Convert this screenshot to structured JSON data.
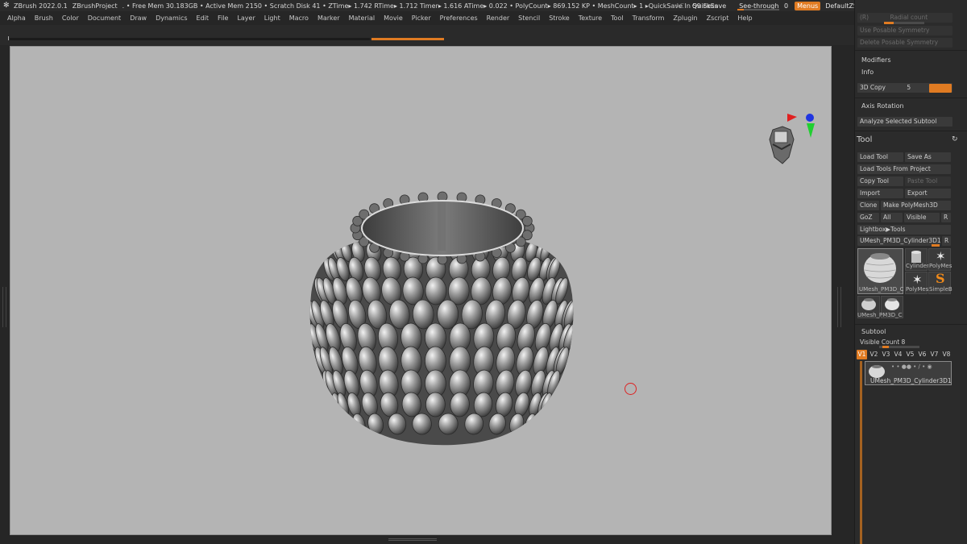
{
  "titlebar": {
    "app": "ZBrush 2022.0.1",
    "project": "ZBrushProject",
    "stats": ". • Free Mem 30.183GB • Active Mem 2150 • Scratch Disk 41 •  ZTime▸ 1.742 RTime▸ 1.712 Timer▸ 1.616 ATime▸ 0.022 • PolyCount▸ 869.152 KP  • MeshCount▸ 1  ▸QuickSave In 59 Secs",
    "ac": "AC",
    "quicksave": "QuickSave",
    "seethrough": "See-through",
    "seethrough_value": "0",
    "seethrough_level": 0.0,
    "menus": "Menus",
    "script": "DefaultZScript"
  },
  "menubar": [
    "Alpha",
    "Brush",
    "Color",
    "Document",
    "Draw",
    "Dynamics",
    "Edit",
    "File",
    "Layer",
    "Light",
    "Macro",
    "Marker",
    "Material",
    "Movie",
    "Picker",
    "Preferences",
    "Render",
    "Stencil",
    "Stroke",
    "Texture",
    "Tool",
    "Transform",
    "Zplugin",
    "Zscript",
    "Help"
  ],
  "tray": {
    "top_items": {
      "radial": "Radial count",
      "radial_prefix": "(R)",
      "use_posable": "Use Posable Symmetry",
      "delete_posable": "Delete Posable Symmetry",
      "modifiers": "Modifiers",
      "info": "Info",
      "copy3d": "3D Copy",
      "copy3d_value": "5",
      "axis_rotation": "Axis Rotation",
      "analyze": "Analyze Selected Subtool"
    },
    "tool": {
      "title": "Tool",
      "load_tool": "Load Tool",
      "save_as": "Save As",
      "load_from_project": "Load Tools From Project",
      "copy_tool": "Copy Tool",
      "paste_tool": "Paste Tool",
      "import": "Import",
      "export": "Export",
      "clone": "Clone",
      "make_polymesh": "Make PolyMesh3D",
      "goz": "GoZ",
      "all": "All",
      "visible": "Visible",
      "r": "R",
      "lightbox": "Lightbox▶Tools",
      "current_tool": "UMesh_PM3D_Cylinder3D1",
      "current_r": "R",
      "thumbs": {
        "main": "UMesh_PM3D_C",
        "cylinder": "Cylinder",
        "polymesh1": "PolyMes",
        "polymesh2": "PolyMes",
        "simple": "SimpleB",
        "umesh2": "UMesh_PM3D_C"
      }
    },
    "subtool": {
      "title": "Subtool",
      "visible_count": "Visible Count 8",
      "tabs": [
        "V1",
        "V2",
        "V3",
        "V4",
        "V5",
        "V6",
        "V7",
        "V8"
      ],
      "item": "UMesh_PM3D_Cylinder3D1"
    }
  },
  "colors": {
    "accent": "#e07b22",
    "canvas": "#b4b4b4",
    "ui_dark": "#262626"
  }
}
